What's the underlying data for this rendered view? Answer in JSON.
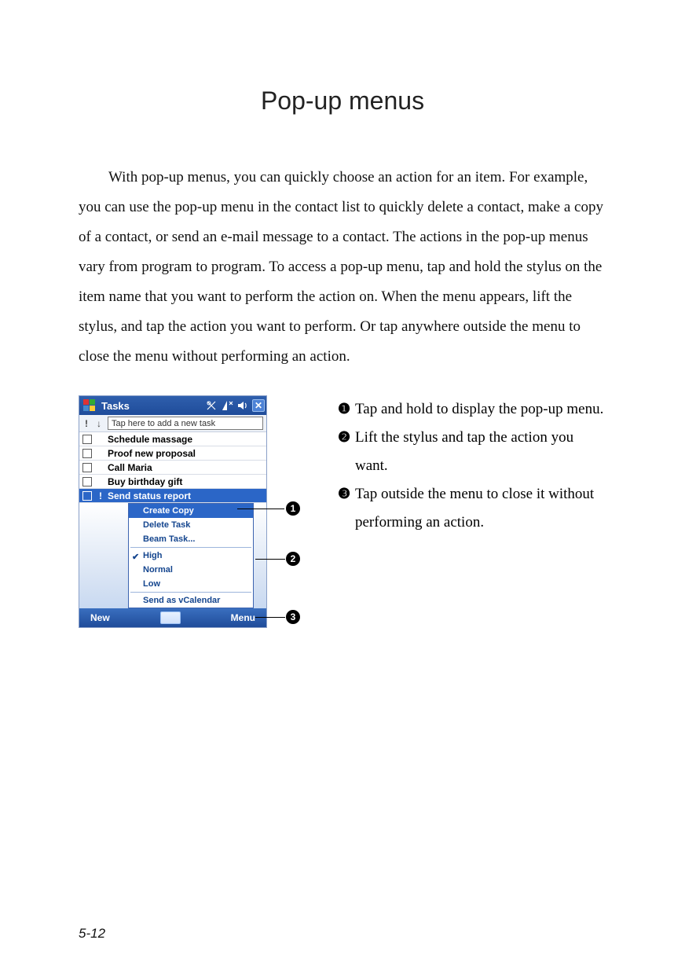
{
  "title": "Pop-up menus",
  "intro": "With pop-up menus, you can quickly choose an action for an item. For example, you can use the pop-up menu in the contact list to quickly delete a contact, make a copy of a contact, or send an e-mail message to a contact. The actions in the pop-up menus vary from program to program. To access a pop-up menu, tap and hold the stylus on the item name that you want to perform the action on. When the menu appears, lift the stylus, and tap the action you want to perform. Or tap anywhere outside the menu to close the menu without performing an action.",
  "device": {
    "title": "Tasks",
    "add_placeholder": "Tap here to add a new task",
    "tasks": [
      {
        "label": "Schedule massage",
        "priority": "",
        "selected": false
      },
      {
        "label": "Proof new proposal",
        "priority": "",
        "selected": false
      },
      {
        "label": "Call Maria",
        "priority": "",
        "selected": false
      },
      {
        "label": "Buy birthday gift",
        "priority": "",
        "selected": false
      },
      {
        "label": "Send status report",
        "priority": "!",
        "selected": true
      }
    ],
    "popup": {
      "items_top": [
        "Create Copy",
        "Delete Task",
        "Beam Task..."
      ],
      "items_pri": [
        "High",
        "Normal",
        "Low"
      ],
      "pri_checked_index": 0,
      "item_bottom": "Send as vCalendar"
    },
    "bottom": {
      "left": "New",
      "right": "Menu"
    }
  },
  "legend": [
    "Tap and hold to display the pop-up menu.",
    "Lift the stylus and tap the action you want.",
    "Tap outside the menu to close it without performing an action."
  ],
  "bullets": [
    "1",
    "2",
    "3"
  ],
  "legend_nums": [
    "❶",
    "❷",
    "❸"
  ],
  "page_number": "5-12"
}
